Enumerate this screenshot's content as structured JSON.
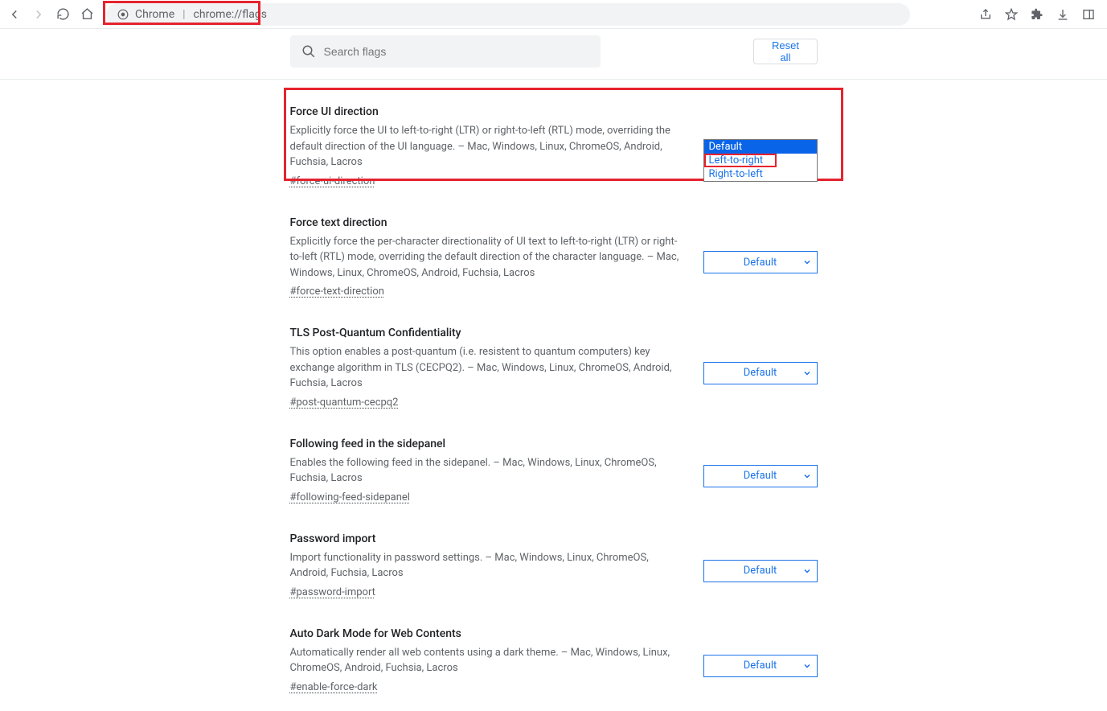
{
  "browser": {
    "scheme_label": "Chrome",
    "url": "chrome://flags"
  },
  "header": {
    "search_placeholder": "Search flags",
    "reset_label": "Reset all"
  },
  "dropdown": {
    "options": [
      "Default",
      "Left-to-right",
      "Right-to-left"
    ],
    "selected": "Default"
  },
  "flags": [
    {
      "title": "Force UI direction",
      "desc": "Explicitly force the UI to left-to-right (LTR) or right-to-left (RTL) mode, overriding the default direction of the UI language. – Mac, Windows, Linux, ChromeOS, Android, Fuchsia, Lacros",
      "id": "#force-ui-direction",
      "value": "Default",
      "open": true
    },
    {
      "title": "Force text direction",
      "desc": "Explicitly force the per-character directionality of UI text to left-to-right (LTR) or right-to-left (RTL) mode, overriding the default direction of the character language. – Mac, Windows, Linux, ChromeOS, Android, Fuchsia, Lacros",
      "id": "#force-text-direction",
      "value": "Default"
    },
    {
      "title": "TLS Post-Quantum Confidentiality",
      "desc": "This option enables a post-quantum (i.e. resistent to quantum computers) key exchange algorithm in TLS (CECPQ2). – Mac, Windows, Linux, ChromeOS, Android, Fuchsia, Lacros",
      "id": "#post-quantum-cecpq2",
      "value": "Default"
    },
    {
      "title": "Following feed in the sidepanel",
      "desc": "Enables the following feed in the sidepanel. – Mac, Windows, Linux, ChromeOS, Fuchsia, Lacros",
      "id": "#following-feed-sidepanel",
      "value": "Default"
    },
    {
      "title": "Password import",
      "desc": "Import functionality in password settings. – Mac, Windows, Linux, ChromeOS, Android, Fuchsia, Lacros",
      "id": "#password-import",
      "value": "Default"
    },
    {
      "title": "Auto Dark Mode for Web Contents",
      "desc": "Automatically render all web contents using a dark theme. – Mac, Windows, Linux, ChromeOS, Android, Fuchsia, Lacros",
      "id": "#enable-force-dark",
      "value": "Default"
    }
  ]
}
